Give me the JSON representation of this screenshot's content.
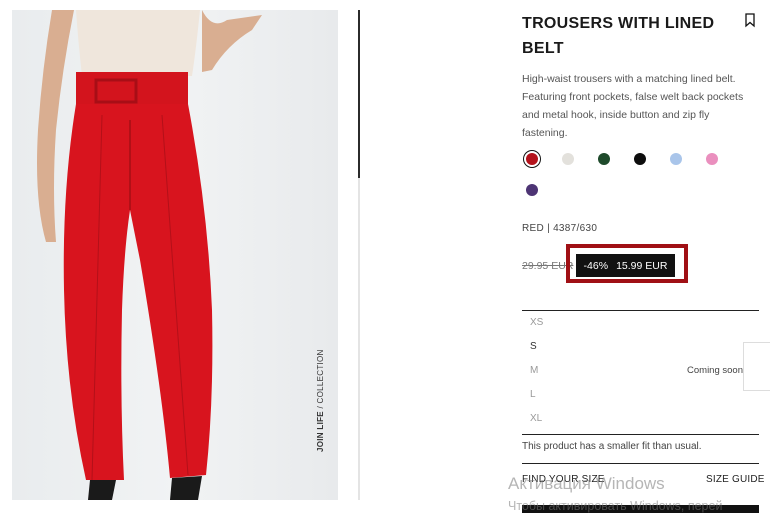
{
  "product": {
    "title": "TROUSERS WITH LINED BELT",
    "description": "High-waist trousers with a matching lined belt. Featuring front pockets, false welt back pockets and metal hook, inside button and zip fly fastening.",
    "image_caption_bold": "JOIN LIFE",
    "image_caption_rest": " / COLLECTION"
  },
  "colors": {
    "swatches": [
      {
        "name": "red",
        "hex": "#b3121b",
        "selected": true
      },
      {
        "name": "ecru",
        "hex": "#e3e1dc"
      },
      {
        "name": "dark-green",
        "hex": "#1e4a2b"
      },
      {
        "name": "black",
        "hex": "#0d0d0d"
      },
      {
        "name": "light-blue",
        "hex": "#a9c5ea"
      },
      {
        "name": "pink",
        "hex": "#ea8fbe"
      },
      {
        "name": "purple",
        "hex": "#4d3474"
      }
    ],
    "selected_ref": "RED | 4387/630"
  },
  "price": {
    "old": "29.95 EUR",
    "discount": "-46%",
    "new": "15.99 EUR",
    "highlight_color": "#a01015"
  },
  "sizes": [
    {
      "label": "XS",
      "available": false
    },
    {
      "label": "S",
      "available": true
    },
    {
      "label": "M",
      "available": false,
      "note": "Coming soon"
    },
    {
      "label": "L",
      "available": false
    },
    {
      "label": "XL",
      "available": false
    }
  ],
  "fit_note": "This product has a smaller fit than usual.",
  "links": {
    "find_size": "FIND YOUR SIZE",
    "size_guide": "SIZE GUIDE"
  },
  "watermark": {
    "line1": "Активация Windows",
    "line2": "Чтобы активировать Windows, перей"
  }
}
